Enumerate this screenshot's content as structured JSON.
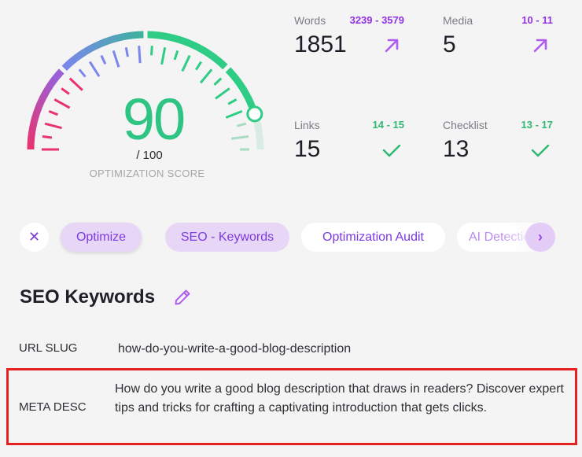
{
  "gauge": {
    "score": "90",
    "max_label": "/ 100",
    "label": "OPTIMIZATION SCORE",
    "fraction": 0.9,
    "colors": {
      "low": "#e8336f",
      "mid": "#7b86ec",
      "high": "#2ecc85",
      "remaining": "#d9ece4"
    }
  },
  "metrics": [
    {
      "label": "Words",
      "range": "3239 - 3579",
      "value": "1851",
      "status": "below",
      "icon": "arrow-up-right-icon"
    },
    {
      "label": "Media",
      "range": "10 - 11",
      "value": "5",
      "status": "below",
      "icon": "arrow-up-right-icon"
    },
    {
      "label": "Links",
      "range": "14 - 15",
      "value": "15",
      "status": "ok",
      "icon": "check-icon"
    },
    {
      "label": "Checklist",
      "range": "13 - 17",
      "value": "13",
      "status": "ok",
      "icon": "check-icon"
    }
  ],
  "chips": {
    "close": "✕",
    "items": [
      "Optimize",
      "SEO - Keywords",
      "Optimization Audit",
      "AI Detection"
    ],
    "next": "›"
  },
  "section": {
    "title": "SEO Keywords"
  },
  "fields": {
    "url_slug": {
      "label": "URL SLUG",
      "value": "how-do-you-write-a-good-blog-description"
    },
    "meta_desc": {
      "label": "META DESC",
      "value": "How do you write a good blog description that draws in readers? Discover expert tips and tricks for crafting a captivating introduction that gets clicks."
    }
  },
  "colors": {
    "accent": "#7c3ae0",
    "purple": "#9233e6",
    "green": "#2fb872",
    "highlight_border": "#e52121"
  }
}
